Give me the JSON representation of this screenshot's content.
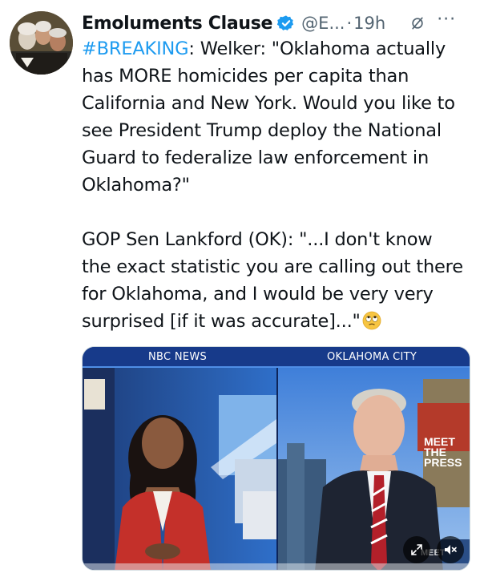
{
  "account": {
    "name": "Emoluments Clause",
    "handle": "@E...",
    "separator": "·",
    "timestamp": "19h",
    "verified": true,
    "icons": {
      "verified": "verified-badge-icon",
      "grok": "grok-icon",
      "more": "more-icon"
    },
    "more_label": "···"
  },
  "tweet": {
    "hashtag": "#BREAKING",
    "p1_rest": ": Welker: \"Oklahoma actually has MORE homicides per capita than California and New York. Would you like to see President Trump deploy the National Guard to federalize law enforcement in Oklahoma?\"",
    "p2": "GOP Sen Lankford (OK): \"...I don't know the exact statistic you are calling out there for Oklahoma, and I would be very very surprised [if it was accurate]...\"",
    "emoji": "face-with-rolling-eyes-emoji"
  },
  "media": {
    "left_label": "NBC NEWS",
    "right_label": "OKLAHOMA CITY",
    "logo_line1": "MEET",
    "logo_line2": "THE PRESS",
    "corner_logo": "MEET",
    "icons": {
      "expand": "expand-icon",
      "mute": "muted-speaker-icon"
    }
  },
  "colors": {
    "accent": "#1d9bf0",
    "text": "#0f1419",
    "secondary_text": "#536471"
  }
}
